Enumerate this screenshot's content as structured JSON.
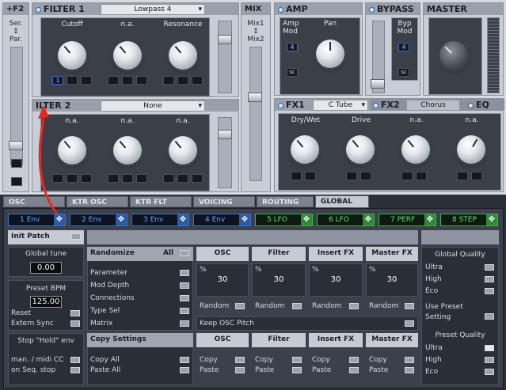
{
  "f2": {
    "title": "F2",
    "ser_par": [
      "Ser.",
      "↕",
      "Par."
    ]
  },
  "filter1": {
    "title": "FILTER 1",
    "type": "Lowpass 4",
    "knobs": [
      "Cutoff",
      "n.a.",
      "Resonance"
    ],
    "mod_value": "1",
    "mod_labels": [
      "~",
      "SC"
    ]
  },
  "filter2": {
    "title": "ILTER 2",
    "type": "None",
    "knobs": [
      "n.a.",
      "n.a.",
      "n.a."
    ]
  },
  "mix": {
    "title": "MIX",
    "labels": [
      "Mix1",
      "↕",
      "Mix2"
    ]
  },
  "amp": {
    "title": "AMP",
    "knobs": [
      "Amp\nMod",
      "Pan"
    ],
    "amp_mod": "4"
  },
  "bypass": {
    "title": "BYPASS",
    "byp_mod": [
      "Byp",
      "Mod"
    ],
    "value": "4"
  },
  "master": {
    "title": "MASTER"
  },
  "fx1": {
    "title": "FX1",
    "type": "C Tube",
    "knobs": [
      "Dry/Wet",
      "Drive",
      "n.a.",
      "n.a."
    ]
  },
  "fx2": {
    "title": "FX2",
    "type": "Chorus"
  },
  "eq": {
    "title": "EQ"
  },
  "tabs": [
    "OSC",
    "KTR OSC",
    "KTR FLT",
    "VOICING",
    "ROUTING",
    "GLOBAL"
  ],
  "mods": [
    "1 Env",
    "2 Env",
    "3 Env",
    "4 Env",
    "5 LFO",
    "6 LFO",
    "7 PERF",
    "8 STEP"
  ],
  "global": {
    "init_patch": "Init Patch",
    "global_tune": "Global tune",
    "tune_value": "0.00",
    "preset_bpm": "Preset BPM",
    "bpm_value": "125.00",
    "reset": "Reset",
    "extern_sync": "Extern Sync",
    "stop_hold": "Stop \"Hold\" env",
    "man_midi": "man. / midi CC",
    "seq_stop": "on Seq. stop",
    "randomize": "Randomize",
    "all": "All",
    "rand_items": [
      "Parameter",
      "Mod Depth",
      "Connections",
      "Type Sel",
      "Matrix"
    ],
    "copy_settings": "Copy Settings",
    "copy_all": "Copy All",
    "paste_all": "Paste All",
    "cols": [
      "OSC",
      "Filter",
      "Insert FX",
      "Master FX"
    ],
    "percent": "%",
    "pct_values": [
      "30",
      "30",
      "30",
      "30"
    ],
    "random": "Random",
    "keep_osc": "Keep OSC Pitch",
    "copy": "Copy",
    "paste": "Paste",
    "gq": "Global Quality",
    "gq_items": [
      "Ultra",
      "High",
      "Eco"
    ],
    "use_preset": [
      "Use Preset",
      "Setting"
    ],
    "pq": "Preset Quality",
    "pq_items": [
      "Ultra",
      "High",
      "Eco"
    ]
  }
}
